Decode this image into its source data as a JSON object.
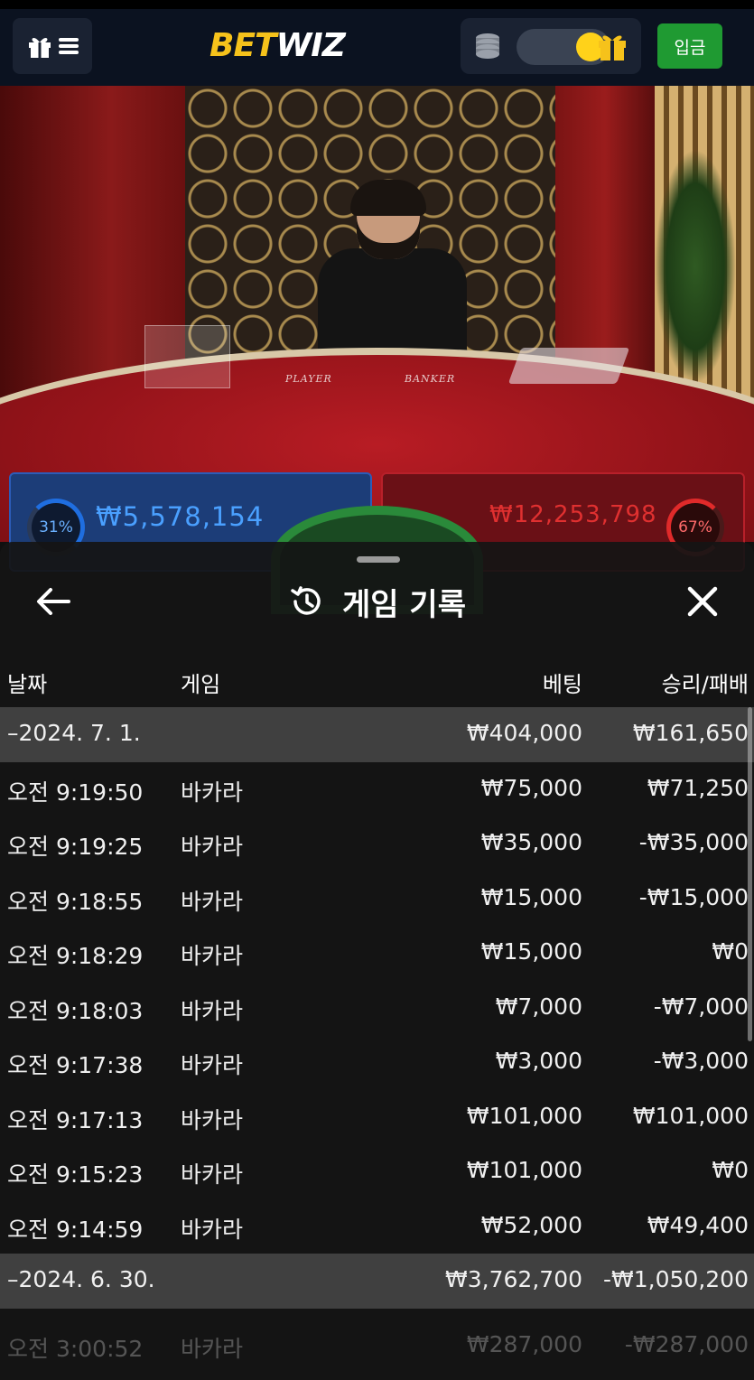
{
  "header": {
    "logo_bet": "BET",
    "logo_wiz": "WIZ",
    "deposit_label": "입금"
  },
  "video": {
    "table_player_label": "PLAYER",
    "table_banker_label": "BANKER",
    "player_pct": "31%",
    "player_amount": "₩5,578,154",
    "banker_pct": "67%",
    "banker_amount": "₩12,253,798"
  },
  "sheet": {
    "title": "게임 기록",
    "columns": {
      "date": "날짜",
      "game": "게임",
      "bet": "베팅",
      "win_loss": "승리/패배"
    },
    "rows": [
      {
        "type": "group",
        "date": "–2024. 7. 1.",
        "game": "",
        "bet": "₩404,000",
        "win_loss": "₩161,650"
      },
      {
        "type": "item",
        "date": "오전 9:19:50",
        "game": "바카라",
        "bet": "₩75,000",
        "win_loss": "₩71,250"
      },
      {
        "type": "item",
        "date": "오전 9:19:25",
        "game": "바카라",
        "bet": "₩35,000",
        "win_loss": "-₩35,000"
      },
      {
        "type": "item",
        "date": "오전 9:18:55",
        "game": "바카라",
        "bet": "₩15,000",
        "win_loss": "-₩15,000"
      },
      {
        "type": "item",
        "date": "오전 9:18:29",
        "game": "바카라",
        "bet": "₩15,000",
        "win_loss": "₩0"
      },
      {
        "type": "item",
        "date": "오전 9:18:03",
        "game": "바카라",
        "bet": "₩7,000",
        "win_loss": "-₩7,000"
      },
      {
        "type": "item",
        "date": "오전 9:17:38",
        "game": "바카라",
        "bet": "₩3,000",
        "win_loss": "-₩3,000"
      },
      {
        "type": "item",
        "date": "오전 9:17:13",
        "game": "바카라",
        "bet": "₩101,000",
        "win_loss": "₩101,000"
      },
      {
        "type": "item",
        "date": "오전 9:15:23",
        "game": "바카라",
        "bet": "₩101,000",
        "win_loss": "₩0"
      },
      {
        "type": "item",
        "date": "오전 9:14:59",
        "game": "바카라",
        "bet": "₩52,000",
        "win_loss": "₩49,400"
      },
      {
        "type": "group",
        "date": "–2024. 6. 30.",
        "game": "",
        "bet": "₩3,762,700",
        "win_loss": "-₩1,050,200"
      }
    ],
    "partial_row": {
      "date": "오전 3:00:52",
      "game": "바카라",
      "bet": "₩287,000",
      "win_loss": "-₩287,000"
    }
  },
  "colors": {
    "header_bg": "#0b1220",
    "logo_yellow": "#f6c21b",
    "deposit_green": "#1f9a32",
    "player_blue": "#4aa0ff",
    "banker_red": "#e03030",
    "group_row_bg": "#5a5a5a"
  },
  "icons": [
    "gift-icon",
    "menu-icon",
    "coins-icon",
    "toggle-switch",
    "gift-icon",
    "back-arrow-icon",
    "history-icon",
    "close-icon"
  ]
}
